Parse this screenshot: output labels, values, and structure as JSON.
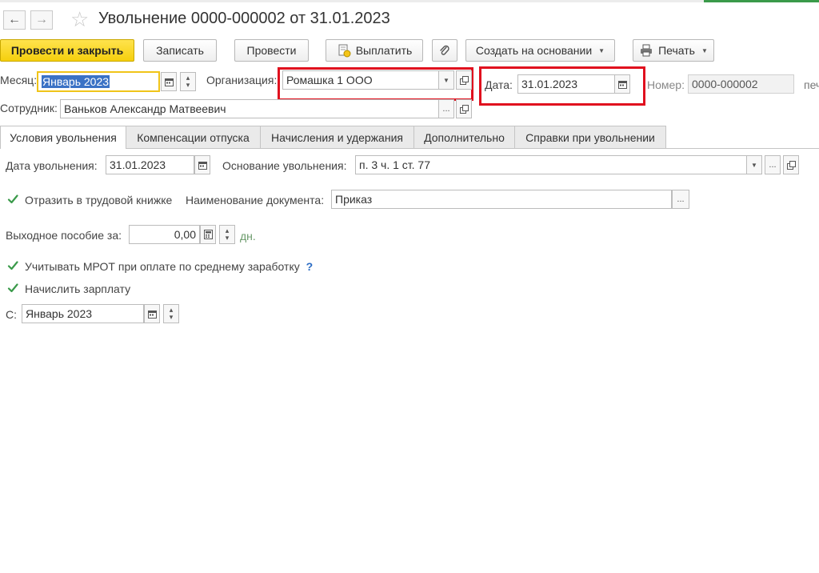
{
  "header": {
    "title": "Увольнение 0000-000002 от 31.01.2023",
    "back_icon": "arrow-left-icon",
    "forward_icon": "arrow-right-icon",
    "favorite_icon": "star-icon"
  },
  "toolbar": {
    "post_close_label": "Провести и закрыть",
    "save_label": "Записать",
    "post_label": "Провести",
    "pay_label": "Выплатить",
    "create_based_label": "Создать на основании",
    "print_label": "Печать",
    "attach_icon": "paperclip-icon"
  },
  "fields": {
    "month_label": "Месяц:",
    "month_value": "Январь 2023",
    "org_label": "Организация:",
    "org_value": "Ромашка 1 ООО",
    "date_label": "Дата:",
    "date_value": "31.01.2023",
    "number_label": "Номер:",
    "number_value": "0000-000002",
    "print_hint": "печ",
    "employee_label": "Сотрудник:",
    "employee_value": "Ваньков Александр Матвеевич"
  },
  "tabs": [
    {
      "label": "Условия увольнения"
    },
    {
      "label": "Компенсации отпуска"
    },
    {
      "label": "Начисления и удержания"
    },
    {
      "label": "Дополнительно"
    },
    {
      "label": "Справки при увольнении"
    }
  ],
  "conditions": {
    "dismissal_date_label": "Дата увольнения:",
    "dismissal_date_value": "31.01.2023",
    "basis_label": "Основание увольнения:",
    "basis_value": "п. 3 ч. 1 ст. 77",
    "reflect_label": "Отразить в трудовой книжке",
    "reflect_checked": true,
    "doc_name_label": "Наименование документа:",
    "doc_name_value": "Приказ",
    "severance_label": "Выходное пособие за:",
    "severance_value": "0,00",
    "severance_unit": "дн.",
    "mrot_label": "Учитывать МРОТ при оплате по среднему заработку",
    "mrot_checked": true,
    "mrot_help": "?",
    "accrue_label": "Начислить зарплату",
    "accrue_checked": true,
    "from_label": "С:",
    "from_value": "Январь 2023"
  },
  "colors": {
    "primary_button": "#f5cf0d",
    "highlight_box": "#e0101e",
    "selection": "#3b72c5",
    "checkbox": "#3a9a4a"
  }
}
